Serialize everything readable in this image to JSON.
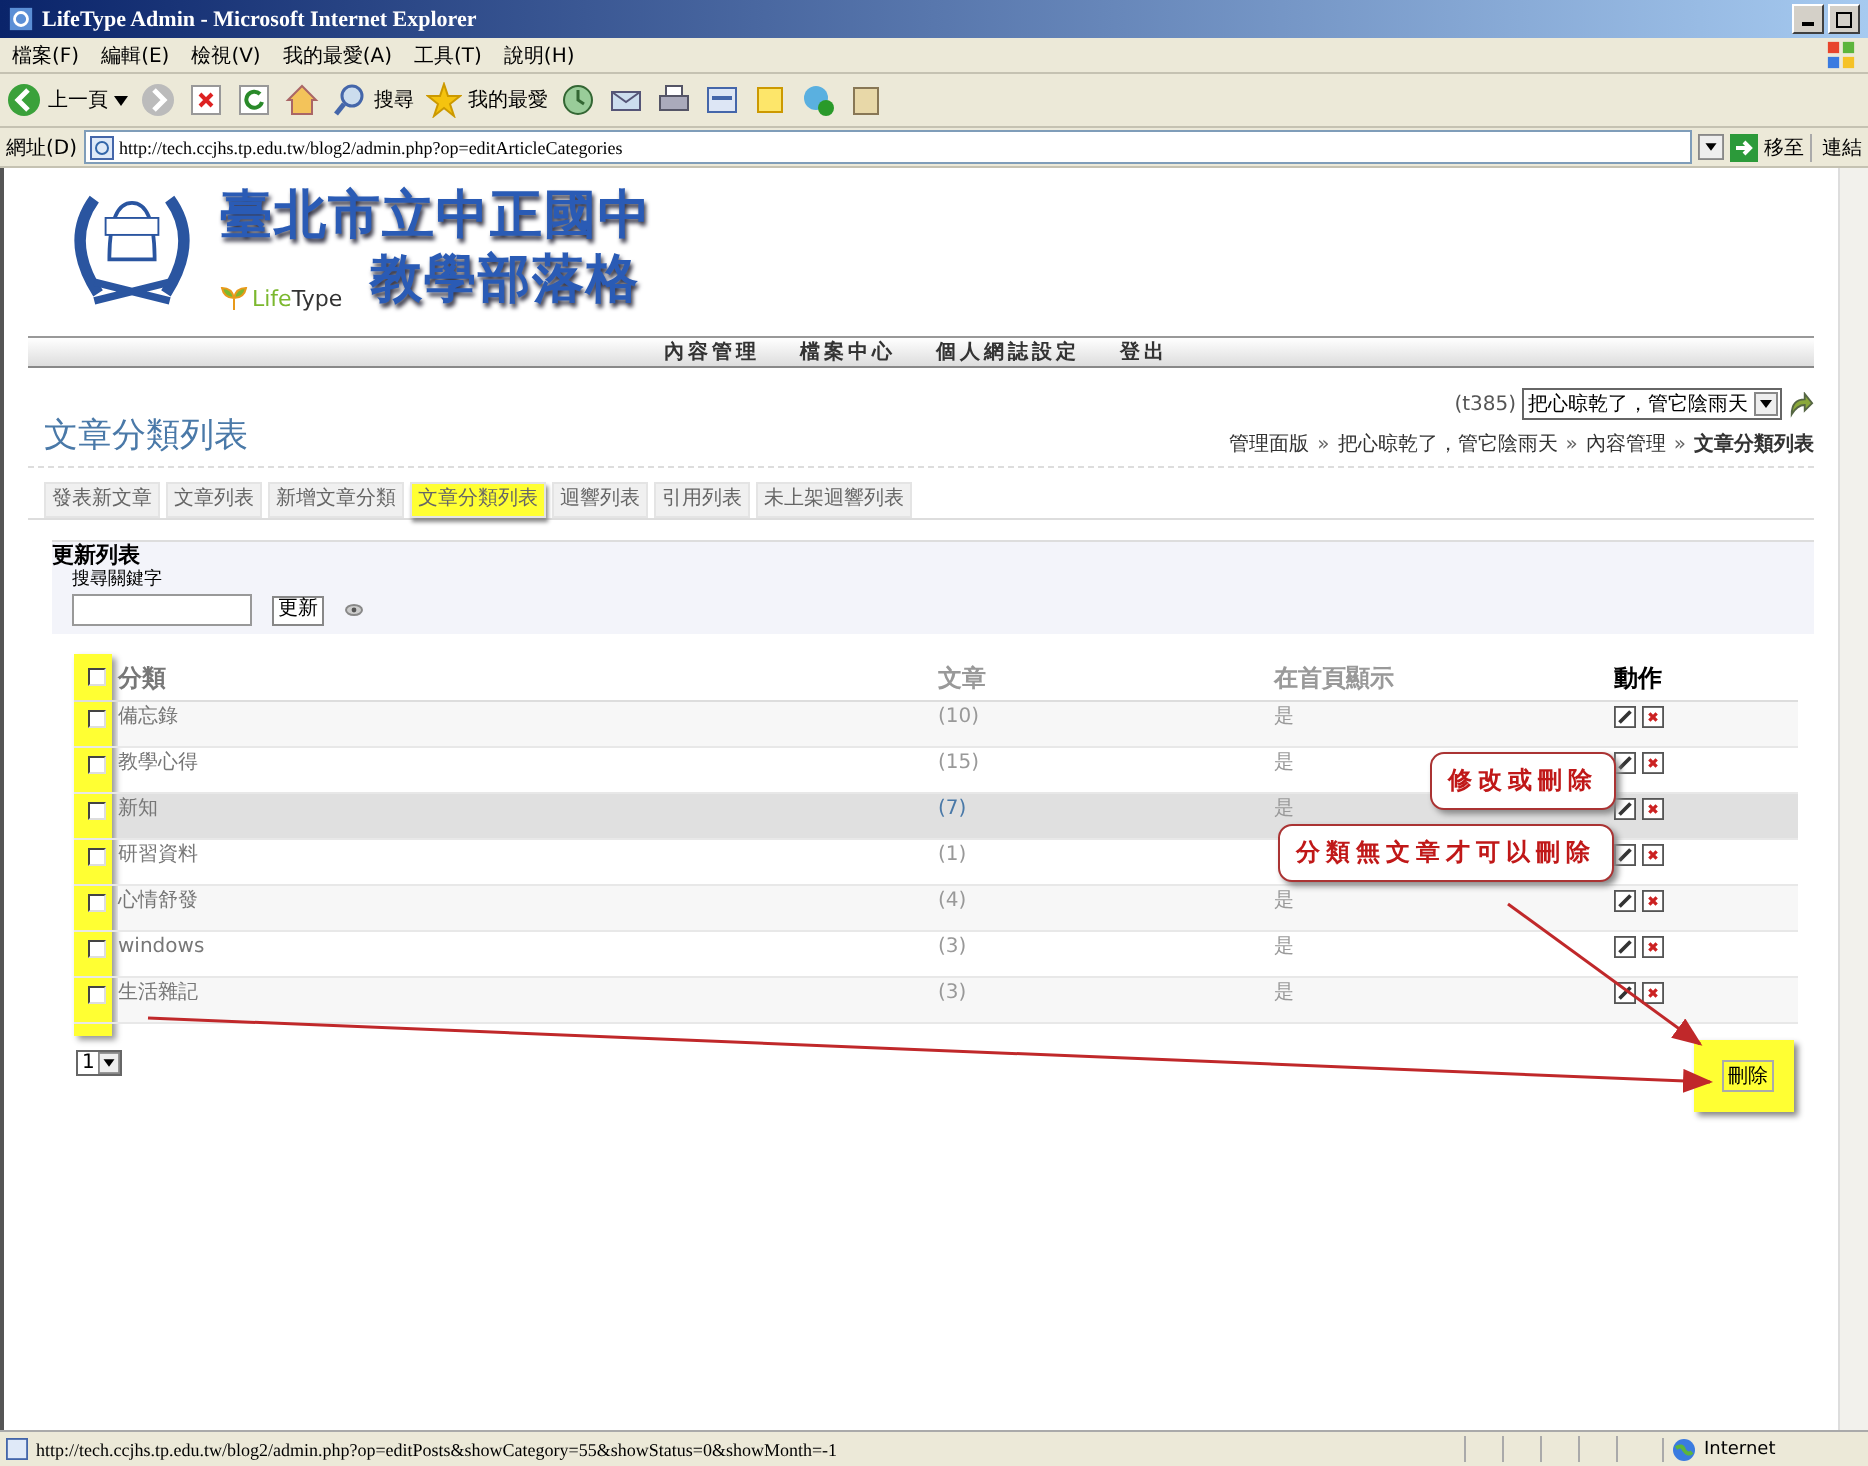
{
  "window": {
    "title": "LifeType Admin - Microsoft Internet Explorer"
  },
  "menu": [
    "檔案(F)",
    "編輯(E)",
    "檢視(V)",
    "我的最愛(A)",
    "工具(T)",
    "說明(H)"
  ],
  "toolbar": {
    "back": "上一頁",
    "search": "搜尋",
    "favorites": "我的最愛"
  },
  "address": {
    "label": "網址(D)",
    "url": "http://tech.ccjhs.tp.edu.tw/blog2/admin.php?op=editArticleCategories",
    "go": "移至",
    "links": "連結"
  },
  "logo": {
    "line1": "臺北市立中正國中",
    "line2": "教學部落格",
    "brand_a": "Life",
    "brand_b": "Type"
  },
  "nav": [
    "內容管理",
    "檔案中心",
    "個人網誌設定",
    "登出"
  ],
  "blog_select": {
    "id": "(t385)",
    "value": "把心晾乾了，管它陰雨天"
  },
  "heading": "文章分類列表",
  "breadcrumb": [
    {
      "text": "管理面版"
    },
    {
      "sep": "»",
      "text": "把心晾乾了，管它陰雨天"
    },
    {
      "sep": "»",
      "text": "內容管理"
    },
    {
      "sep": "»",
      "text": "文章分類列表"
    }
  ],
  "tabs": [
    {
      "label": "發表新文章",
      "selected": false
    },
    {
      "label": "文章列表",
      "selected": false
    },
    {
      "label": "新增文章分類",
      "selected": false
    },
    {
      "label": "文章分類列表",
      "selected": true
    },
    {
      "label": "迴響列表",
      "selected": false
    },
    {
      "label": "引用列表",
      "selected": false
    },
    {
      "label": "未上架迴響列表",
      "selected": false
    }
  ],
  "filter": {
    "legend": "更新列表",
    "label": "搜尋關鍵字",
    "button": "更新"
  },
  "table": {
    "columns": [
      "分類",
      "文章",
      "在首頁顯示",
      "動作"
    ],
    "header_checked": false,
    "rows": [
      {
        "name": "備忘錄",
        "count": "(10)",
        "shown": "是",
        "checked": false,
        "highlighted": false
      },
      {
        "name": "教學心得",
        "count": "(15)",
        "shown": "是",
        "checked": false,
        "highlighted": false
      },
      {
        "name": "新知",
        "count": "(7)",
        "shown": "是",
        "checked": false,
        "highlighted": true
      },
      {
        "name": "研習資料",
        "count": "(1)",
        "checked": false,
        "highlighted": false
      },
      {
        "name": "心情舒發",
        "count": "(4)",
        "shown": "是",
        "checked": false,
        "highlighted": false
      },
      {
        "name": "windows",
        "count": "(3)",
        "shown": "是",
        "checked": false,
        "highlighted": false
      },
      {
        "name": "生活雜記",
        "count": "(3)",
        "shown": "是",
        "checked": false,
        "highlighted": false
      }
    ]
  },
  "pager": "1",
  "delete_button": "刪除",
  "callouts": [
    "修改或刪除",
    "分類無文章才可以刪除"
  ],
  "status_bar": {
    "url": "http://tech.ccjhs.tp.edu.tw/blog2/admin.php?op=editPosts&showCategory=55&showStatus=0&showMonth=-1",
    "zone": "Internet"
  }
}
